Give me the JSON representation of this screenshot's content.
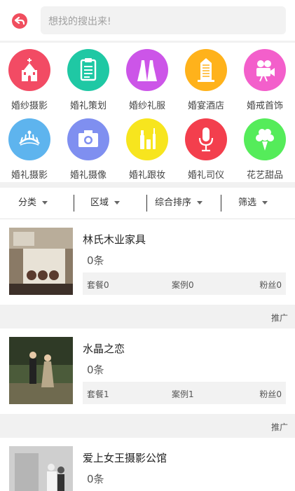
{
  "search": {
    "placeholder": "想找的搜出来!"
  },
  "categories": [
    {
      "label": "婚纱摄影",
      "icon": "church-icon",
      "color": "#f24b64"
    },
    {
      "label": "婚礼策划",
      "icon": "clipboard-icon",
      "color": "#1fc8a4"
    },
    {
      "label": "婚纱礼服",
      "icon": "dress-icon",
      "color": "#cc55e8"
    },
    {
      "label": "婚宴酒店",
      "icon": "hotel-building-icon",
      "color": "#ffb21b"
    },
    {
      "label": "婚戒首饰",
      "icon": "camera-icon",
      "color": "#f35fcb"
    },
    {
      "label": "婚礼摄影",
      "icon": "crown-icon",
      "color": "#5eb4ee"
    },
    {
      "label": "婚礼摄像",
      "icon": "camera-icon",
      "color": "#7f8ff0"
    },
    {
      "label": "婚礼跟妆",
      "icon": "makeup-icon",
      "color": "#f7e51e"
    },
    {
      "label": "婚礼司仪",
      "icon": "microphone-icon",
      "color": "#f33f4d"
    },
    {
      "label": "花艺甜品",
      "icon": "bouquet-icon",
      "color": "#55ec5a"
    }
  ],
  "filters": [
    "分类",
    "区域",
    "综合排序",
    "筛选"
  ],
  "listings": [
    {
      "title": "林氏木业家具",
      "count": "0条",
      "packages": "套餐0",
      "cases": "案例0",
      "fans": "粉丝0"
    },
    {
      "title": "水晶之恋",
      "count": "0条",
      "packages": "套餐1",
      "cases": "案例1",
      "fans": "粉丝0"
    },
    {
      "title": "爱上女王摄影公馆",
      "count": "0条"
    }
  ],
  "promo_label": "推广"
}
